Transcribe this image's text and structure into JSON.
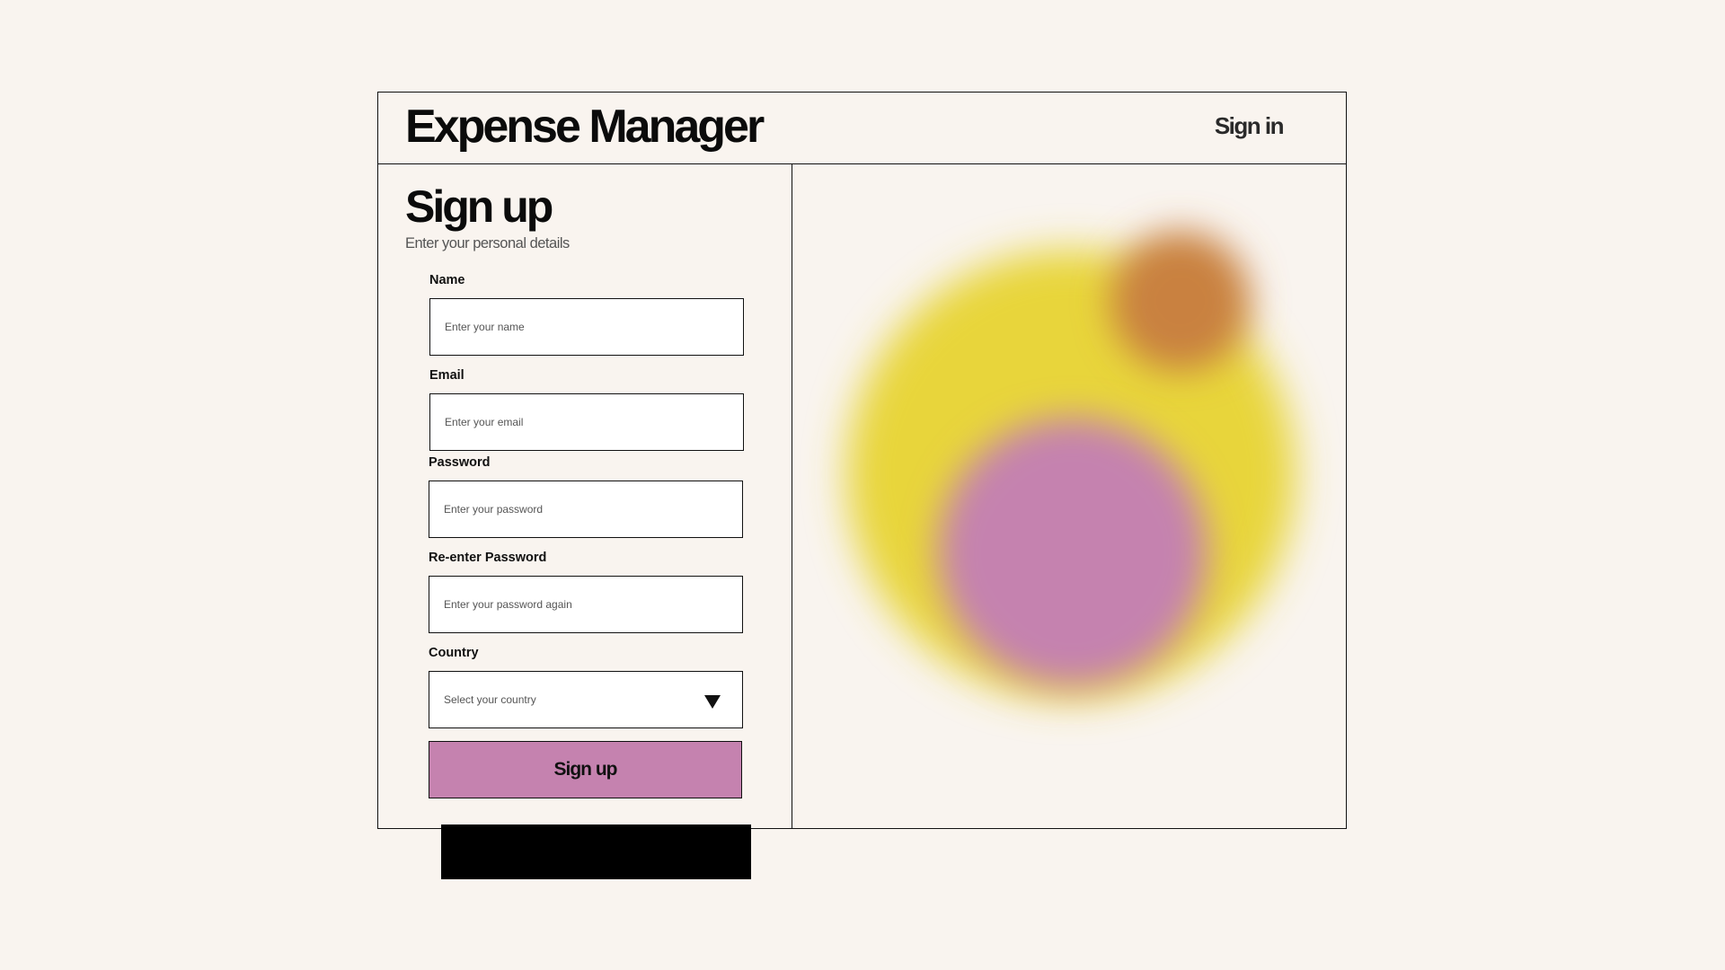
{
  "header": {
    "app_title": "Expense Manager",
    "signin_label": "Sign in"
  },
  "form": {
    "title": "Sign up",
    "subtitle": "Enter your personal details",
    "fields": [
      {
        "label": "Name",
        "placeholder": "Enter your name",
        "value": ""
      },
      {
        "label": "Email",
        "placeholder": "Enter your email",
        "value": ""
      },
      {
        "label": "Password",
        "placeholder": "Enter your password",
        "value": ""
      },
      {
        "label": "Re-enter Password",
        "placeholder": "Enter your password again",
        "value": ""
      }
    ],
    "country": {
      "label": "Country",
      "selected_text": "Select your country"
    },
    "submit_label": "Sign up"
  },
  "colors": {
    "background": "#f9f4ef",
    "accent": "#c582af",
    "blob_yellow": "#e8d53a",
    "blob_pink": "#c582af",
    "blob_orange": "#c9813f"
  },
  "icons": {
    "country_dropdown": "chevron-down-icon"
  }
}
